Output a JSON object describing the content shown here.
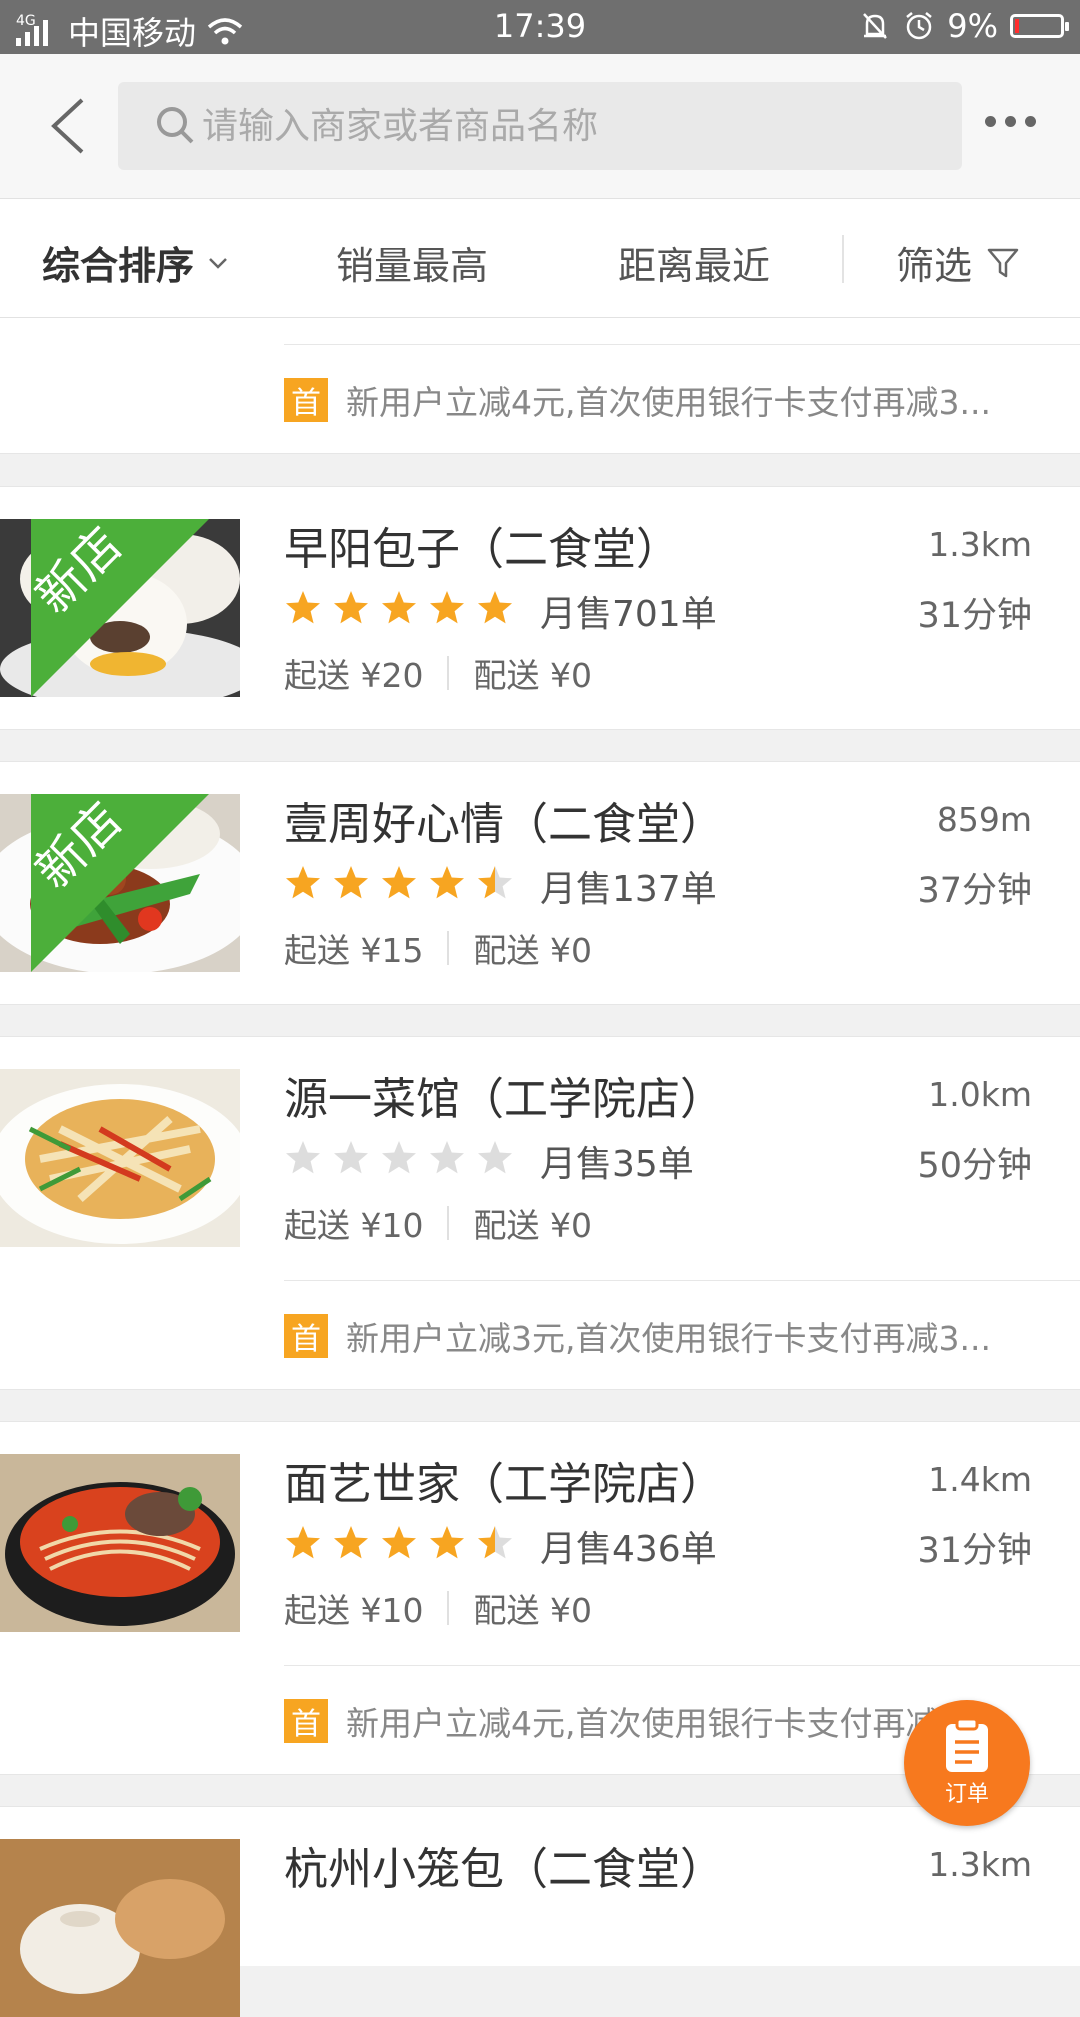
{
  "status_bar": {
    "network_type": "4G",
    "carrier": "中国移动",
    "time": "17:39",
    "battery": "9%",
    "battery_level": 0.09
  },
  "header": {
    "search_placeholder": "请输入商家或者商品名称"
  },
  "sort_bar": {
    "items": [
      "综合排序",
      "销量最高",
      "距离最近",
      "筛选"
    ],
    "active_index": 0
  },
  "shops": [
    {
      "promo": {
        "badge": "首",
        "text": "新用户立减4元,首次使用银行卡支付再减3..."
      }
    },
    {
      "name": "早阳包子（二食堂）",
      "new_tag": "新店",
      "rating": 5,
      "sales": "月售701单",
      "distance": "1.3km",
      "time": "31分钟",
      "min_order": "起送 ¥20",
      "delivery_fee": "配送 ¥0"
    },
    {
      "name": "壹周好心情（二食堂）",
      "new_tag": "新店",
      "rating": 4.5,
      "sales": "月售137单",
      "distance": "859m",
      "time": "37分钟",
      "min_order": "起送 ¥15",
      "delivery_fee": "配送 ¥0"
    },
    {
      "name": "源一菜馆（工学院店）",
      "rating": 0,
      "sales": "月售35单",
      "distance": "1.0km",
      "time": "50分钟",
      "min_order": "起送 ¥10",
      "delivery_fee": "配送 ¥0",
      "promo": {
        "badge": "首",
        "text": "新用户立减3元,首次使用银行卡支付再减3..."
      }
    },
    {
      "name": "面艺世家（工学院店）",
      "rating": 4.5,
      "sales": "月售436单",
      "distance": "1.4km",
      "time": "31分钟",
      "min_order": "起送 ¥10",
      "delivery_fee": "配送 ¥0",
      "promo": {
        "badge": "首",
        "text": "新用户立减4元,首次使用银行卡支付再减3..."
      }
    },
    {
      "name": "杭州小笼包（二食堂）",
      "distance": "1.3km"
    }
  ],
  "fab": {
    "label": "订单"
  },
  "colors": {
    "accent": "#f7a521",
    "fab": "#f7791e",
    "new_tag": "#4caf3a",
    "star_empty": "#dddddd"
  }
}
